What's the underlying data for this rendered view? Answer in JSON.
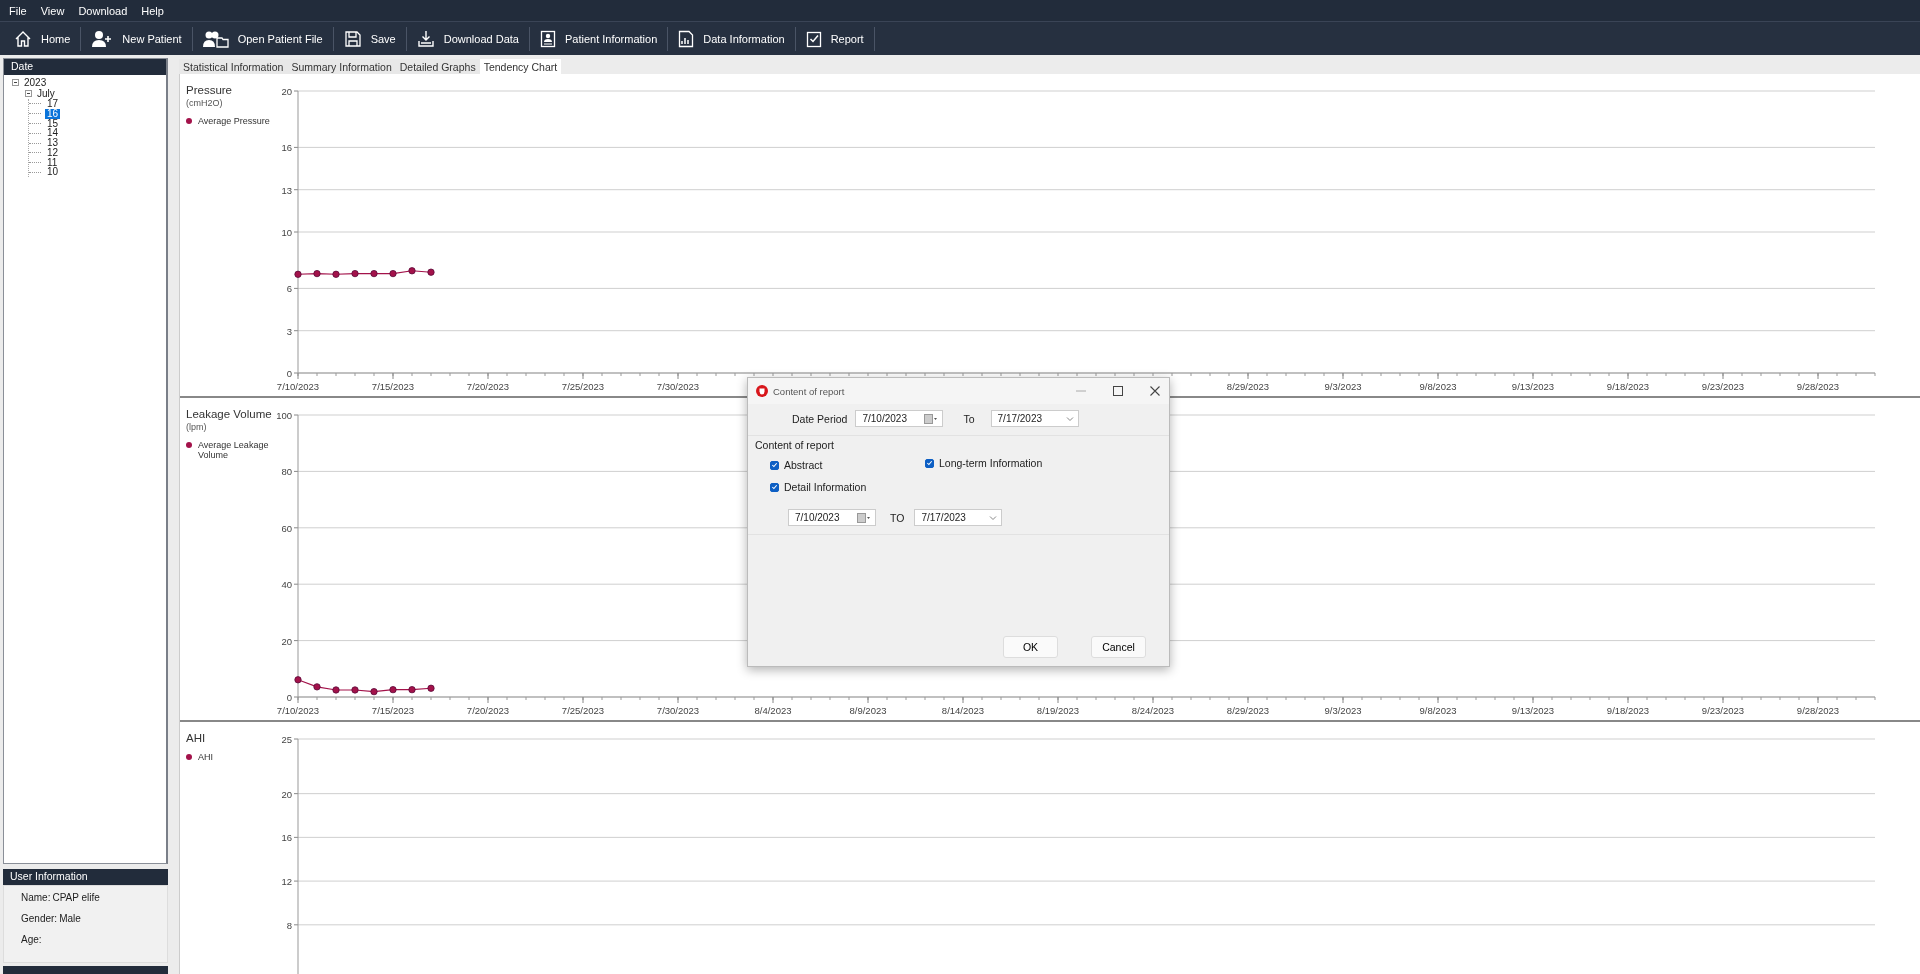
{
  "menu": [
    "File",
    "View",
    "Download",
    "Help"
  ],
  "toolbar": [
    {
      "label": "Home"
    },
    {
      "label": "New Patient"
    },
    {
      "label": "Open Patient File"
    },
    {
      "label": "Save"
    },
    {
      "label": "Download Data"
    },
    {
      "label": "Patient Information"
    },
    {
      "label": "Data Information"
    },
    {
      "label": "Report"
    }
  ],
  "sidebar": {
    "header": "Date",
    "tree": [
      {
        "label": "2023",
        "expanded": true,
        "children": [
          {
            "label": "July",
            "expanded": true,
            "children": [
              {
                "label": "17",
                "selected": false
              },
              {
                "label": "16",
                "selected": true
              },
              {
                "label": "15",
                "selected": false
              },
              {
                "label": "14",
                "selected": false
              },
              {
                "label": "13",
                "selected": false
              },
              {
                "label": "12",
                "selected": false
              },
              {
                "label": "11",
                "selected": false
              },
              {
                "label": "10",
                "selected": false
              }
            ]
          }
        ]
      }
    ],
    "user_info": {
      "header": "User Information",
      "fields": [
        {
          "label": "Name:",
          "value": "CPAP elife"
        },
        {
          "label": "Gender:",
          "value": "Male"
        },
        {
          "label": "Age:"
        }
      ]
    }
  },
  "tabs": [
    {
      "label": "Statistical Information",
      "selected": false
    },
    {
      "label": "Summary Information",
      "selected": false
    },
    {
      "label": "Detailed Graphs",
      "selected": false
    },
    {
      "label": "Tendency Chart",
      "selected": true
    }
  ],
  "charts": [
    {
      "title": "Pressure",
      "unit": "(cmH2O)",
      "chart_data": {
        "type": "line",
        "grid": true,
        "ylim": [
          0,
          20
        ],
        "categories": [
          "7/10/2023",
          null,
          null,
          null,
          null,
          "7/15/2023",
          null,
          null,
          null,
          null,
          "7/20/2023",
          null,
          null,
          null,
          null,
          "7/25/2023",
          null,
          null,
          null,
          null,
          "7/30/2023",
          null,
          null,
          null,
          null,
          null,
          null,
          null,
          null,
          null,
          null,
          null,
          null,
          null,
          null,
          null,
          null,
          null,
          null,
          null,
          null,
          null,
          null,
          null,
          null,
          null,
          null,
          null,
          null,
          null,
          "8/29/2023",
          null,
          null,
          null,
          null,
          "9/3/2023",
          null,
          null,
          null,
          null,
          "9/8/2023",
          null,
          null,
          null,
          null,
          "9/13/2023",
          null,
          null,
          null,
          null,
          "9/18/2023",
          null,
          null,
          null,
          null,
          "9/23/2023",
          null,
          null,
          null,
          null,
          "9/28/2023",
          null,
          null,
          null
        ],
        "series": [
          {
            "name": "Average Pressure",
            "color": "#a3124a",
            "marker": "circle",
            "values": [
              7.0,
              7.05,
              7.0,
              7.05,
              7.05,
              7.05,
              7.25,
              7.15,
              null,
              null,
              null,
              null,
              null,
              null,
              null,
              null,
              null,
              null,
              null,
              null,
              null,
              null,
              null,
              null,
              null,
              null,
              null,
              null,
              null,
              null,
              null,
              null,
              null,
              null,
              null,
              null,
              null,
              null,
              null,
              null,
              null,
              null,
              null,
              null,
              null,
              null,
              null,
              null,
              null,
              null,
              null,
              null,
              null,
              null,
              null,
              null,
              null,
              null,
              null,
              null,
              null,
              null,
              null,
              null,
              null,
              null,
              null,
              null,
              null,
              null,
              null,
              null,
              null,
              null,
              null,
              null,
              null,
              null,
              null,
              null,
              null,
              null,
              null,
              null
            ]
          }
        ],
        "yticks": [
          0,
          3,
          6,
          10,
          13,
          16,
          20
        ]
      }
    },
    {
      "title": "Leakage Volume",
      "unit": "(lpm)",
      "chart_data": {
        "type": "line",
        "grid": true,
        "ylim": [
          0,
          100
        ],
        "categories": [
          "7/10/2023",
          null,
          null,
          null,
          null,
          "7/15/2023",
          null,
          null,
          null,
          null,
          "7/20/2023",
          null,
          null,
          null,
          null,
          "7/25/2023",
          null,
          null,
          null,
          null,
          "7/30/2023",
          null,
          null,
          null,
          null,
          "8/4/2023",
          null,
          null,
          null,
          null,
          "8/9/2023",
          null,
          null,
          null,
          null,
          "8/14/2023",
          null,
          null,
          null,
          null,
          "8/19/2023",
          null,
          null,
          null,
          null,
          "8/24/2023",
          null,
          null,
          null,
          null,
          "8/29/2023",
          null,
          null,
          null,
          null,
          "9/3/2023",
          null,
          null,
          null,
          null,
          "9/8/2023",
          null,
          null,
          null,
          null,
          "9/13/2023",
          null,
          null,
          null,
          null,
          "9/18/2023",
          null,
          null,
          null,
          null,
          "9/23/2023",
          null,
          null,
          null,
          null,
          "9/28/2023",
          null,
          null,
          null
        ],
        "series": [
          {
            "name": "Average Leakage Volume",
            "color": "#a3124a",
            "marker": "circle",
            "values": [
              6.1,
              3.6,
              2.5,
              2.5,
              1.9,
              2.6,
              2.6,
              3.1,
              null,
              null,
              null,
              null,
              null,
              null,
              null,
              null,
              null,
              null,
              null,
              null,
              null,
              null,
              null,
              null,
              null,
              null,
              null,
              null,
              null,
              null,
              null,
              null,
              null,
              null,
              null,
              null,
              null,
              null,
              null,
              null,
              null,
              null,
              null,
              null,
              null,
              null,
              null,
              null,
              null,
              null,
              null,
              null,
              null,
              null,
              null,
              null,
              null,
              null,
              null,
              null,
              null,
              null,
              null,
              null,
              null,
              null,
              null,
              null,
              null,
              null,
              null,
              null,
              null,
              null,
              null,
              null,
              null,
              null,
              null,
              null,
              null,
              null,
              null,
              null
            ]
          }
        ],
        "yticks": [
          0,
          20,
          40,
          60,
          80,
          100
        ]
      }
    },
    {
      "title": "AHI",
      "chart_data": {
        "type": "line",
        "grid": true,
        "ylim": [
          3.5,
          25
        ],
        "series": [
          {
            "name": "AHI",
            "color": "#a3124a"
          }
        ],
        "yticks": [
          8,
          12,
          16,
          20,
          25
        ]
      }
    }
  ],
  "dialog": {
    "title": "Content of report",
    "date_period": {
      "label": "Date Period",
      "from": "7/10/2023",
      "to_label": "To",
      "to": "7/17/2023"
    },
    "section": "Content of report",
    "options": [
      {
        "label": "Abstract",
        "checked": true
      },
      {
        "label": "Long-term Information",
        "checked": true
      },
      {
        "label": "Detail Information",
        "checked": true
      }
    ],
    "detail_period": {
      "from": "7/10/2023",
      "to_label": "TO",
      "to": "7/17/2023"
    },
    "buttons": [
      "OK",
      "Cancel"
    ]
  }
}
